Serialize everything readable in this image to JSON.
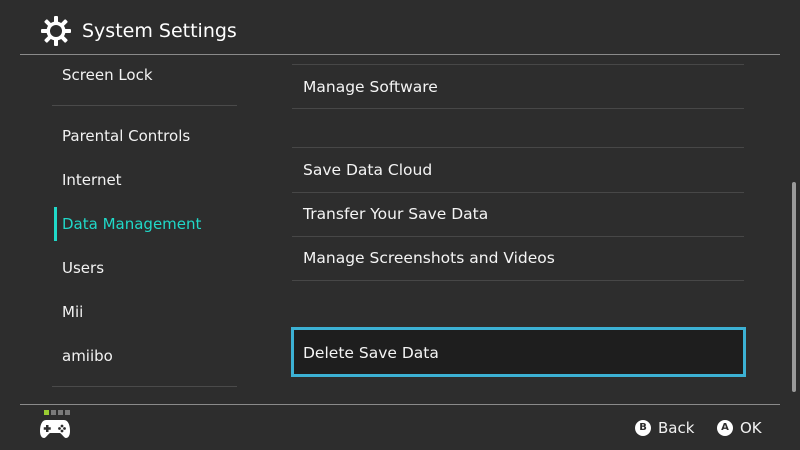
{
  "header": {
    "title": "System Settings",
    "icon": "gear-icon"
  },
  "sidebar": {
    "items": [
      {
        "label": "Screen Lock",
        "selected": false
      },
      {
        "label": "Parental Controls",
        "selected": false
      },
      {
        "label": "Internet",
        "selected": false
      },
      {
        "label": "Data Management",
        "selected": true
      },
      {
        "label": "Users",
        "selected": false
      },
      {
        "label": "Mii",
        "selected": false
      },
      {
        "label": "amiibo",
        "selected": false
      }
    ]
  },
  "main": {
    "items": [
      {
        "label": "Manage Software",
        "focused": false
      },
      {
        "label": "Save Data Cloud",
        "focused": false
      },
      {
        "label": "Transfer Your Save Data",
        "focused": false
      },
      {
        "label": "Manage Screenshots and Videos",
        "focused": false
      },
      {
        "label": "Delete Save Data",
        "focused": true
      }
    ]
  },
  "footer": {
    "controller_icon": "controller-icon",
    "back": {
      "button": "B",
      "label": "Back"
    },
    "ok": {
      "button": "A",
      "label": "OK"
    }
  },
  "colors": {
    "background": "#2d2d2d",
    "accent": "#20d8c8",
    "focus_border": "#3cb1d4",
    "focus_fill": "#1e1e1e"
  }
}
